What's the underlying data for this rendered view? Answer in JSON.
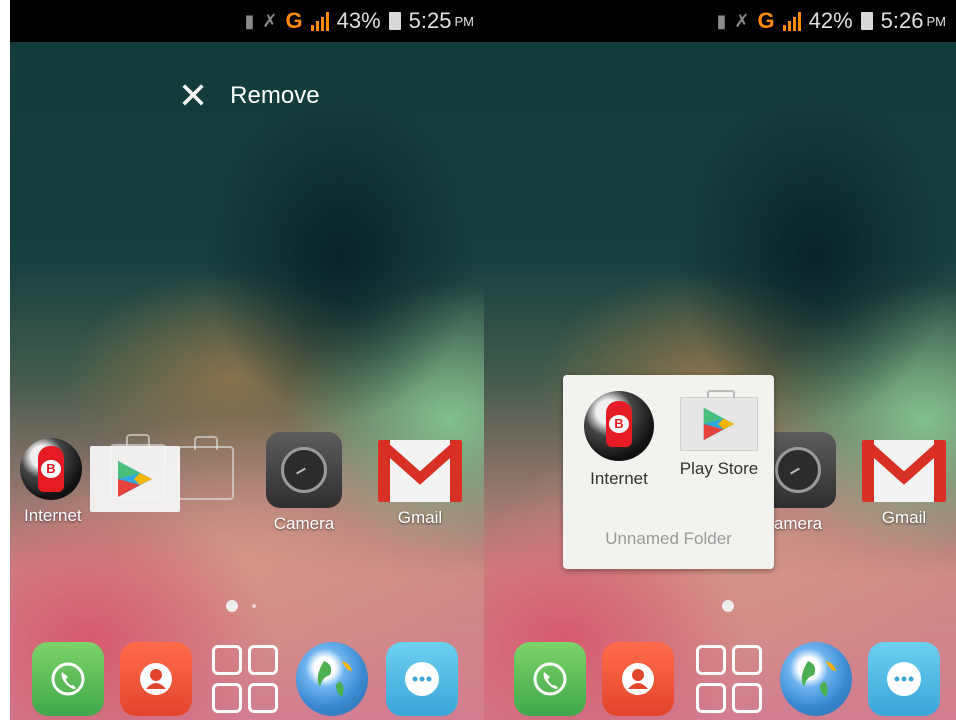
{
  "left": {
    "status": {
      "battery": "43%",
      "time": "5:25",
      "ampm": "PM",
      "network": "G"
    },
    "remove_label": "Remove",
    "apps": {
      "internet": "Internet",
      "camera": "Camera",
      "gmail": "Gmail"
    }
  },
  "right": {
    "status": {
      "battery": "42%",
      "time": "5:26",
      "ampm": "PM",
      "network": "G"
    },
    "folder": {
      "name": "Unnamed Folder",
      "items": [
        "Internet",
        "Play Store"
      ]
    },
    "apps": {
      "camera": "amera",
      "gmail": "Gmail"
    }
  },
  "colors": {
    "network": "#ff8a00",
    "statusbar": "#000000",
    "folder_bg": "#f2f2ef"
  },
  "icons": [
    "bluetooth-icon",
    "mute-icon",
    "signal-icon",
    "battery-icon",
    "close-icon",
    "camera-icon",
    "gmail-icon",
    "internet-icon",
    "play-store-icon",
    "phone-icon",
    "contacts-icon",
    "app-drawer-icon",
    "browser-icon",
    "messages-icon"
  ]
}
